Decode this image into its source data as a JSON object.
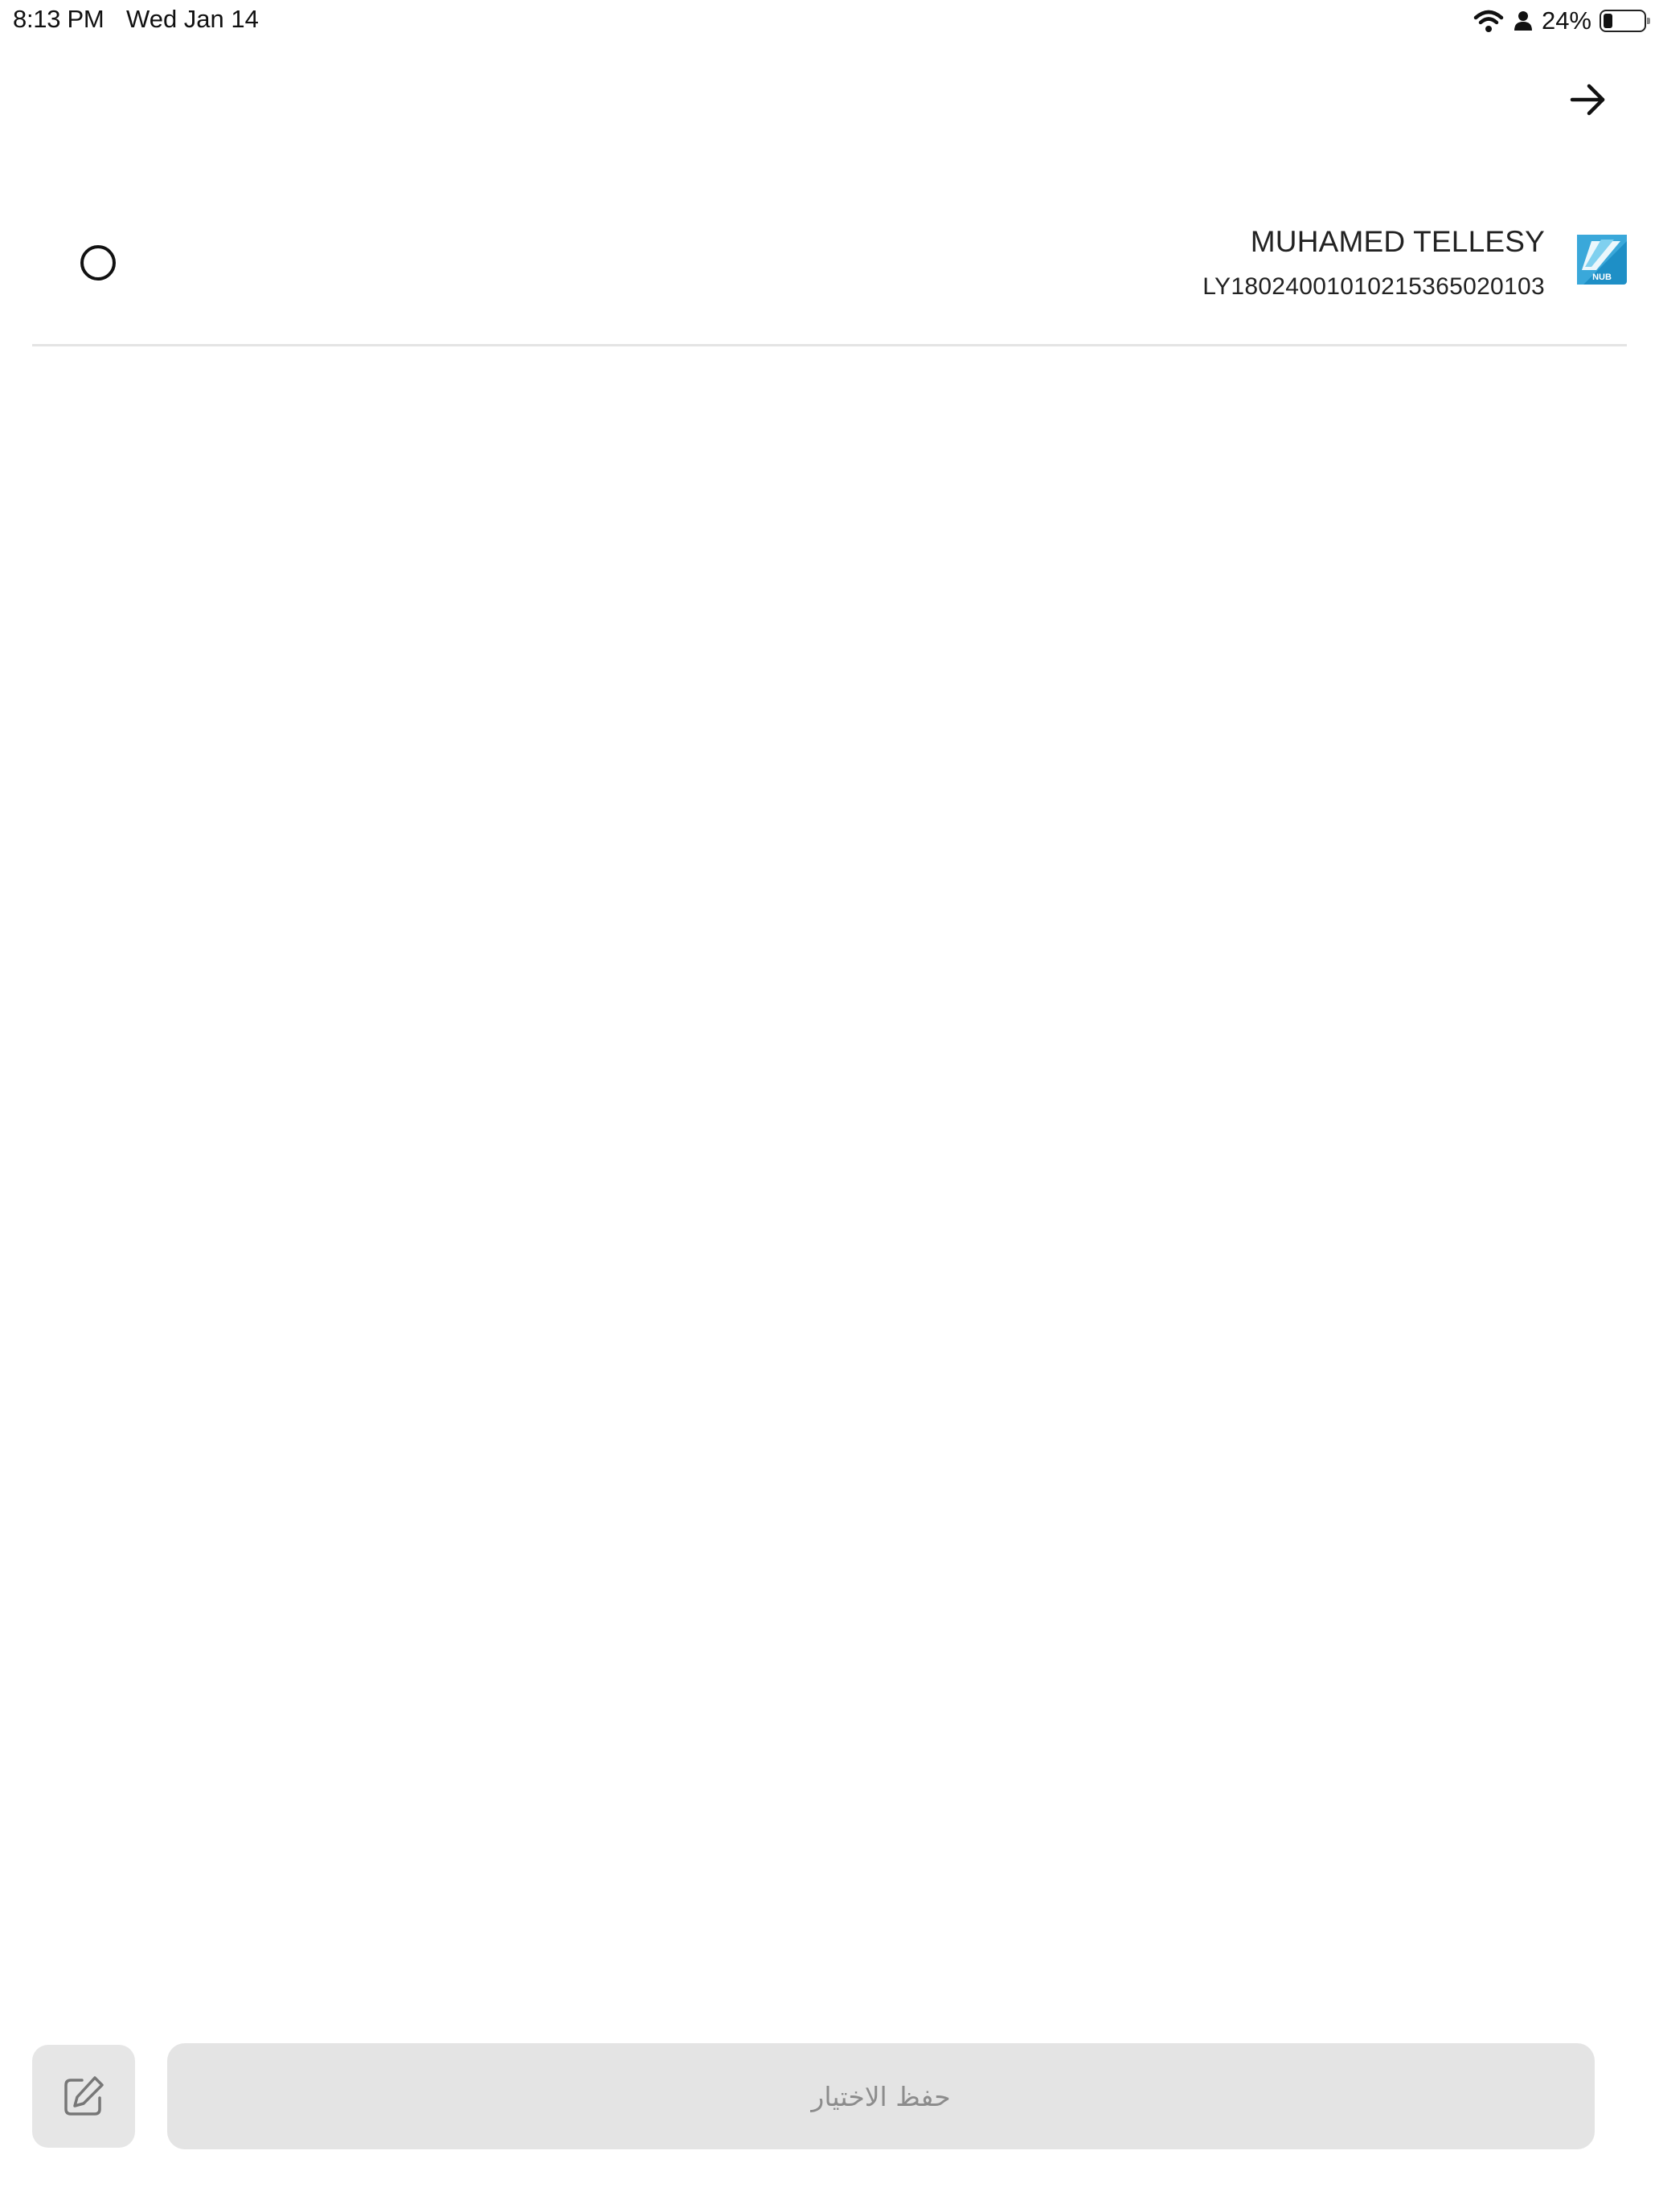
{
  "status_bar": {
    "time": "8:13 PM",
    "date": "Wed Jan 14",
    "battery_percent": "24%",
    "battery_level": 0.24,
    "icons": [
      "wifi-icon",
      "person-icon",
      "battery-icon"
    ]
  },
  "nav": {
    "back_icon": "arrow-right-icon"
  },
  "account": {
    "name": "MUHAMED TELLESY",
    "iban": "LY18024001010215365020103",
    "selected": false,
    "logo_text": "NUB",
    "logo_colors": {
      "primary": "#1e8fc6",
      "accent": "#7fd0ef"
    }
  },
  "footer": {
    "save_label": "حفظ الاختيار",
    "edit_icon": "edit-icon"
  }
}
